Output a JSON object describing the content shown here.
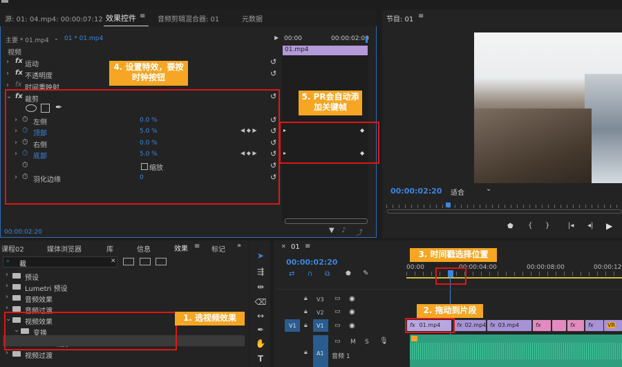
{
  "effect_controls": {
    "tabs": [
      "源: 01: 04.mp4: 00:00:07:12",
      "效果控件",
      "音频剪辑混合器: 01",
      "元数据"
    ],
    "tab_menu": "≡",
    "source_label": "主要 * 01.mp4",
    "sequence_label": "01 * 01.mp4",
    "timeline_ruler": [
      "00:00",
      "00:00:02:00"
    ],
    "clip_name": "01.mp4",
    "section_video": "视频",
    "effects": [
      {
        "name": "运动"
      },
      {
        "name": "不透明度"
      },
      {
        "name": "时间重映射"
      },
      {
        "name": "裁剪"
      }
    ],
    "crop_params": [
      {
        "name": "左侧",
        "value": "0.0 %"
      },
      {
        "name": "顶部",
        "value": "5.0 %"
      },
      {
        "name": "右侧",
        "value": "0.0 %"
      },
      {
        "name": "底部",
        "value": "5.0 %"
      }
    ],
    "zoom_checkbox": "缩放",
    "feather_label": "羽化边缘",
    "feather_value": "0",
    "timecode": "00:00:02:20"
  },
  "program_monitor": {
    "title": "节目: 01",
    "menu": "≡",
    "timecode": "00:00:02:20",
    "fit_select": "适合"
  },
  "effects_panel": {
    "tabs": [
      "课程02",
      "媒体浏览器",
      "库",
      "信息",
      "效果",
      "标记"
    ],
    "more": "»",
    "search_value": "裁",
    "tree": [
      {
        "label": "预设",
        "level": 0
      },
      {
        "label": "Lumetri 预设",
        "level": 0
      },
      {
        "label": "音频效果",
        "level": 0
      },
      {
        "label": "音频过渡",
        "level": 0
      },
      {
        "label": "视频效果",
        "level": 0
      },
      {
        "label": "变换",
        "level": 1
      },
      {
        "label": "裁剪",
        "level": 2
      },
      {
        "label": "视频过渡",
        "level": 0
      }
    ]
  },
  "timeline": {
    "sequence": "01",
    "menu": "≡",
    "timecode": "00:00:02:20",
    "ruler": [
      "00:00",
      "00:00:04:00",
      "00:00:08:00",
      "00:00:12:0"
    ],
    "tracks": [
      "V3",
      "V2",
      "V1",
      "A1"
    ],
    "v1_source": "V1",
    "a1_name": "音频 1",
    "a1_buttons": [
      "M",
      "S"
    ],
    "clips": [
      "01.mp4",
      "02.mp4",
      "03.mp4"
    ],
    "fx_badge": "fx",
    "end_badge": "VR"
  },
  "annotations": {
    "a1": "1. 选视频效果",
    "a2": "2. 拖动到片段",
    "a3": "3. 时间戳选择位置",
    "a4": "4. 设置特效，要按时钟按钮",
    "a5": "5. PR会自动添加关键帧"
  },
  "colors": {
    "accent_blue": "#3b86e0",
    "annotation_orange": "#f6a623",
    "highlight_red": "#e01616",
    "clip_purple": "#9b8cd4",
    "clip_pink": "#e38bc0",
    "audio_green": "#2f9e7e"
  }
}
